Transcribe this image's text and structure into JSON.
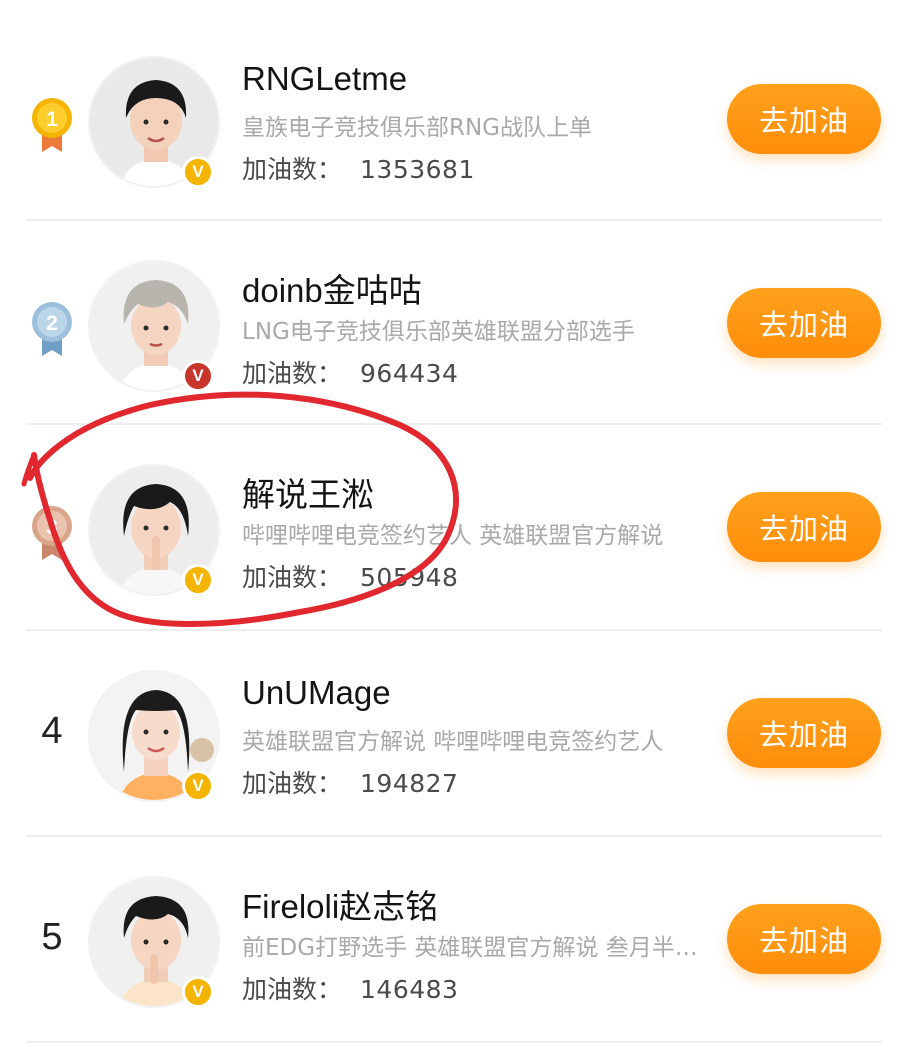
{
  "button_label": "去加油",
  "cheer_label": "加油数：",
  "ranking": [
    {
      "rank": "1",
      "medal_color": "#f5b400",
      "name": "RNGLetme",
      "desc": "皇族电子竞技俱乐部RNG战队上单",
      "cheers": "1353681",
      "verified_color": "#f5b400",
      "avatar_bg": "#e9e9e9",
      "hair_color": "#1a1a1a"
    },
    {
      "rank": "2",
      "medal_color": "#8fb3cf",
      "name": "doinb金咕咕",
      "desc": "LNG电子竞技俱乐部英雄联盟分部选手",
      "cheers": "964434",
      "verified_color": "#c8352b",
      "avatar_bg": "#f0f0f0",
      "hair_color": "#b8b4ae"
    },
    {
      "rank": "3",
      "medal_color": "#d9a58a",
      "name": "解说王淞",
      "desc": "哔哩哔哩电竞签约艺人 英雄联盟官方解说",
      "cheers": "505948",
      "verified_color": "#f5b400",
      "avatar_bg": "#ededed",
      "hair_color": "#1a1a1a"
    },
    {
      "rank": "4",
      "medal_color": "",
      "name": "UnUMage",
      "desc": "英雄联盟官方解说 哔哩哔哩电竞签约艺人",
      "cheers": "194827",
      "verified_color": "#f5b400",
      "avatar_bg": "#f3f3f3",
      "hair_color": "#1c1c1c"
    },
    {
      "rank": "5",
      "medal_color": "",
      "name": "Fireloli赵志铭",
      "desc": "前EDG打野选手 英雄联盟官方解说 叁月半…",
      "cheers": "146483",
      "verified_color": "#f5b400",
      "avatar_bg": "#f0f0f0",
      "hair_color": "#1a1a1a"
    }
  ],
  "annotation_color": "#e0282e"
}
